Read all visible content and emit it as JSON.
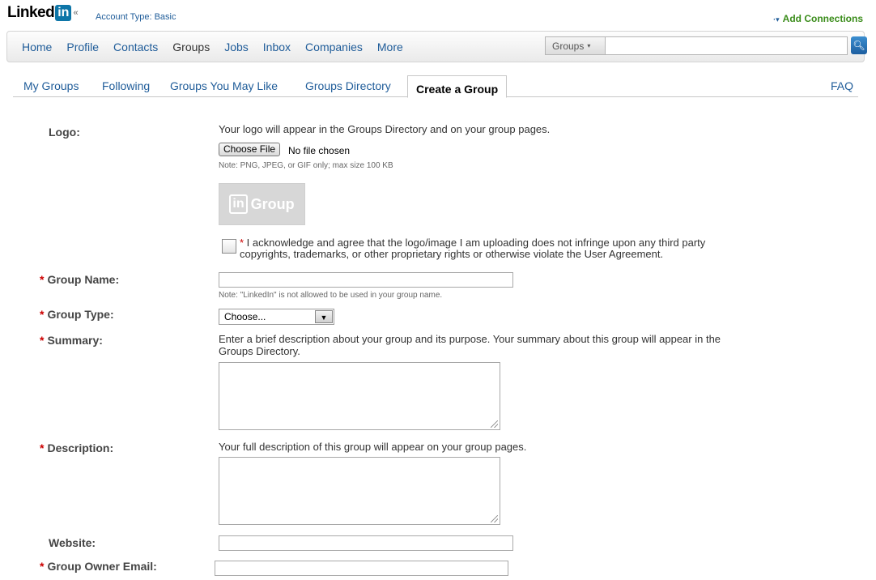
{
  "brand": {
    "logo_word": "Linked",
    "logo_in": "in",
    "account_type": "Account Type: Basic"
  },
  "top_right": {
    "add_connections": "Add Connections"
  },
  "nav": {
    "items": [
      "Home",
      "Profile",
      "Contacts",
      "Groups",
      "Jobs",
      "Inbox",
      "Companies",
      "More"
    ],
    "active": "Groups",
    "search_scope": "Groups",
    "search_value": ""
  },
  "subtabs": {
    "items": [
      "My Groups",
      "Following",
      "Groups You May Like",
      "Groups Directory"
    ],
    "current": "Create a Group",
    "faq": "FAQ"
  },
  "form": {
    "logo": {
      "label": "Logo:",
      "help": "Your logo will appear in the Groups Directory and on your group pages.",
      "choose_file": "Choose File",
      "no_file": "No file chosen",
      "note": "Note: PNG, JPEG, or GIF only; max size 100 KB",
      "placeholder_text": "Group",
      "placeholder_badge": "in",
      "ack_line1": "I acknowledge and agree that the logo/image I am uploading does not infringe upon any third party",
      "ack_line2": "copyrights, trademarks, or other proprietary rights or otherwise violate the User Agreement.",
      "ack_checked": false
    },
    "group_name": {
      "label": "Group Name:",
      "value": "",
      "note": "Note: \"LinkedIn\" is not allowed to be used in your group name."
    },
    "group_type": {
      "label": "Group Type:",
      "value": "Choose..."
    },
    "summary": {
      "label": "Summary:",
      "help_line1": "Enter a brief description about your group and its purpose. Your summary about this group will appear in the",
      "help_line2": "Groups Directory.",
      "value": ""
    },
    "description": {
      "label": "Description:",
      "help": "Your full description of this group will appear on your group pages.",
      "value": ""
    },
    "website": {
      "label": "Website:",
      "value": ""
    },
    "owner_email": {
      "label": "Group Owner Email:",
      "value": ""
    }
  },
  "colors": {
    "link": "#1f5c99",
    "required": "#cc0000",
    "add_connections": "#3a8c1a",
    "brand_blue": "#0e76a8"
  }
}
